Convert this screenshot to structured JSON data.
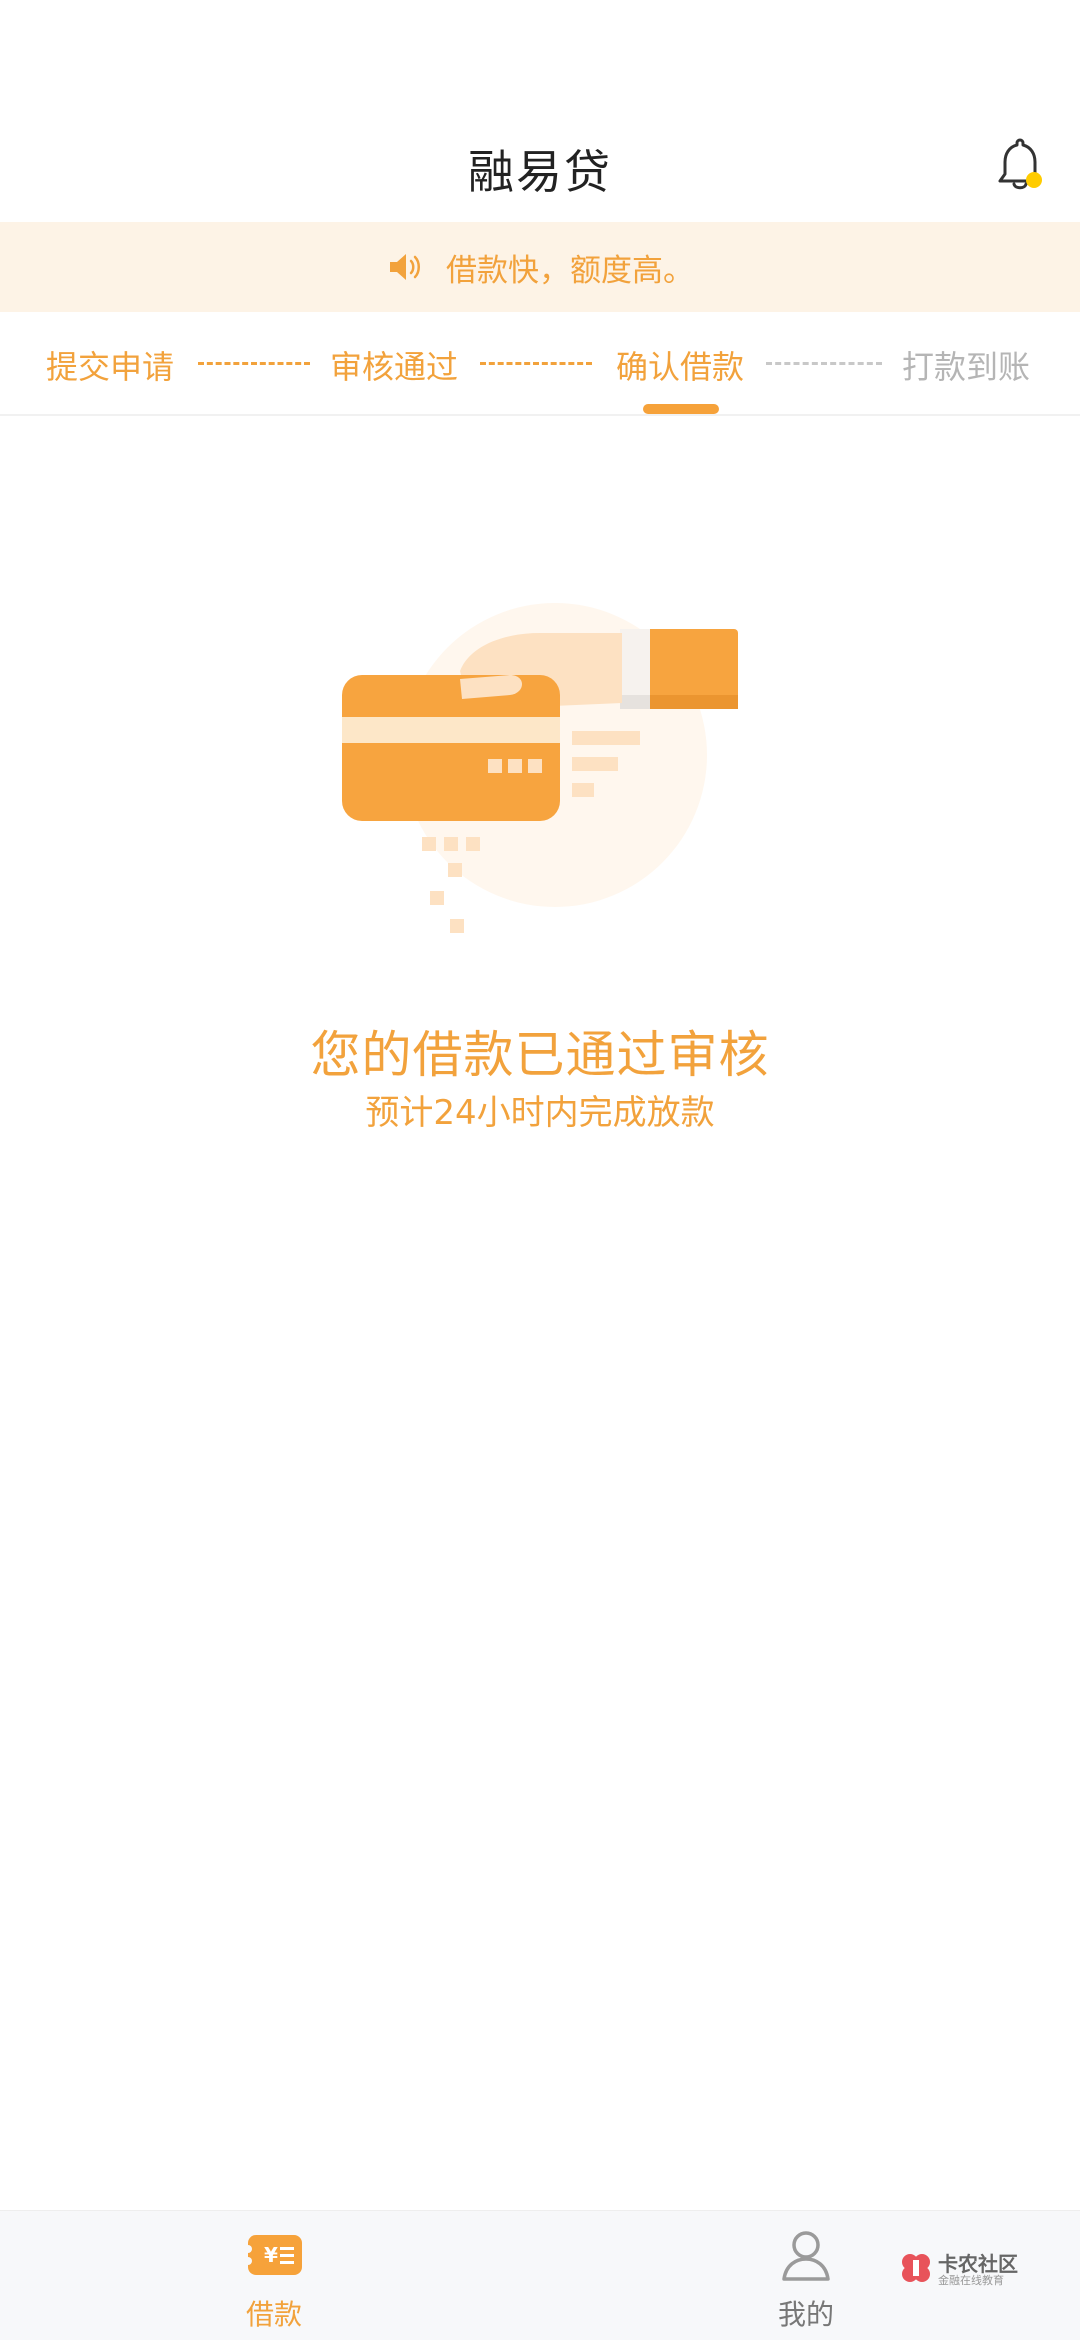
{
  "header": {
    "title": "融易贷",
    "bell_icon": "bell-icon",
    "bell_badge_color": "#ffcc00"
  },
  "notice": {
    "icon": "speaker-icon",
    "text": "借款快，额度高。"
  },
  "steps": {
    "items": [
      {
        "label": "提交申请",
        "state": "done"
      },
      {
        "label": "审核通过",
        "state": "done"
      },
      {
        "label": "确认借款",
        "state": "current"
      },
      {
        "label": "打款到账",
        "state": "pending"
      }
    ]
  },
  "status": {
    "illustration": "hand-card-illustration",
    "title": "您的借款已通过审核",
    "subtitle": "预计24小时内完成放款"
  },
  "bottom_nav": {
    "tabs": [
      {
        "label": "借款",
        "icon": "loan-icon",
        "active": true
      },
      {
        "label": "我的",
        "icon": "user-icon",
        "active": false
      }
    ]
  },
  "watermark": {
    "title": "卡农社区",
    "subtitle": "金融在线教育"
  },
  "colors": {
    "accent": "#f2a23c",
    "notice_bg": "#fdf3e6",
    "inactive": "#b5b5b5"
  }
}
